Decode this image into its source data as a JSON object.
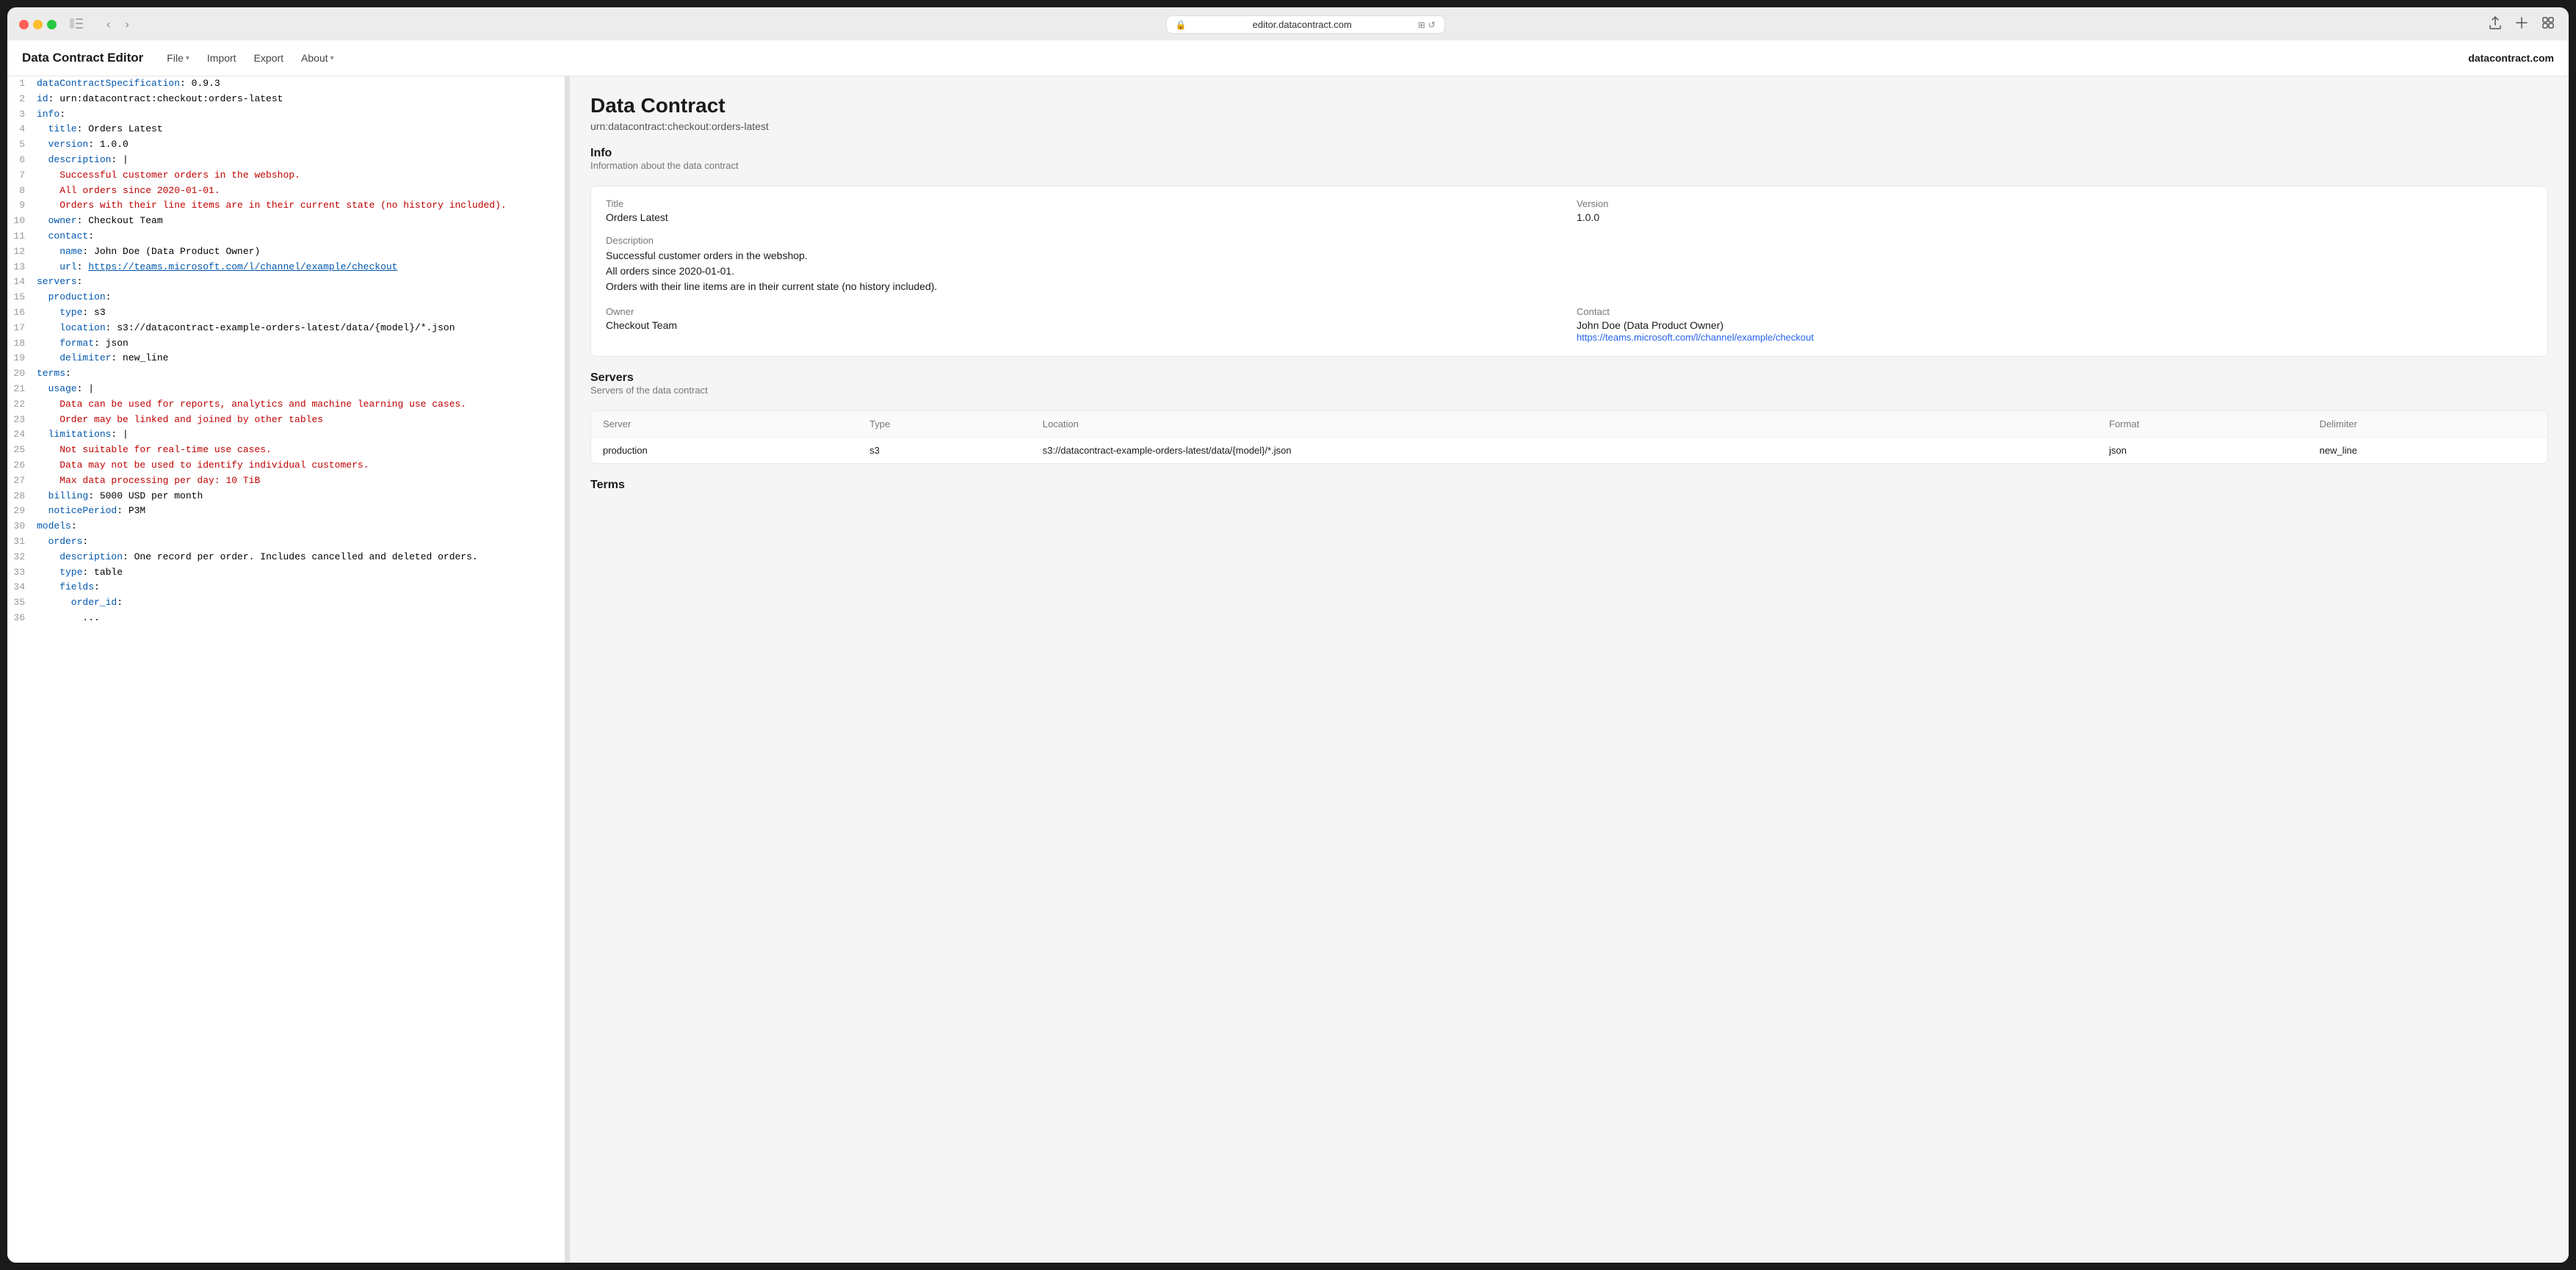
{
  "browser": {
    "url": "editor.datacontract.com",
    "back_title": "back",
    "forward_title": "forward"
  },
  "app": {
    "title": "Data Contract Editor",
    "site": "datacontract.com",
    "menu": {
      "file_label": "File",
      "import_label": "Import",
      "export_label": "Export",
      "about_label": "About"
    }
  },
  "editor": {
    "lines": [
      {
        "num": 1,
        "content": "dataContractSpecification: 0.9.3",
        "tokens": [
          {
            "text": "dataContractSpecification",
            "cls": "key"
          },
          {
            "text": ": 0.9.3",
            "cls": ""
          }
        ]
      },
      {
        "num": 2,
        "content": "id: urn:datacontract:checkout:orders-latest",
        "tokens": [
          {
            "text": "id",
            "cls": "key"
          },
          {
            "text": ": urn:datacontract:checkout:orders-latest",
            "cls": ""
          }
        ]
      },
      {
        "num": 3,
        "content": "info:",
        "tokens": [
          {
            "text": "info",
            "cls": "key"
          },
          {
            "text": ":",
            "cls": ""
          }
        ]
      },
      {
        "num": 4,
        "content": "  title: Orders Latest",
        "tokens": [
          {
            "text": "  title",
            "cls": "key"
          },
          {
            "text": ": Orders Latest",
            "cls": ""
          }
        ]
      },
      {
        "num": 5,
        "content": "  version: 1.0.0",
        "tokens": [
          {
            "text": "  version",
            "cls": "key"
          },
          {
            "text": ": 1.0.0",
            "cls": ""
          }
        ]
      },
      {
        "num": 6,
        "content": "  description: |",
        "tokens": [
          {
            "text": "  description",
            "cls": "key"
          },
          {
            "text": ": |",
            "cls": ""
          }
        ]
      },
      {
        "num": 7,
        "content": "    Successful customer orders in the webshop.",
        "tokens": [
          {
            "text": "    Successful customer orders in the webshop.",
            "cls": "string"
          }
        ]
      },
      {
        "num": 8,
        "content": "    All orders since 2020-01-01.",
        "tokens": [
          {
            "text": "    All orders since 2020-01-01.",
            "cls": "string"
          }
        ]
      },
      {
        "num": 9,
        "content": "    Orders with their line items are in their current state (no history included).",
        "tokens": [
          {
            "text": "    Orders with their line items are in their current state (no history included).",
            "cls": "string"
          }
        ]
      },
      {
        "num": 10,
        "content": "  owner: Checkout Team",
        "tokens": [
          {
            "text": "  owner",
            "cls": "key"
          },
          {
            "text": ": Checkout Team",
            "cls": ""
          }
        ]
      },
      {
        "num": 11,
        "content": "  contact:",
        "tokens": [
          {
            "text": "  contact",
            "cls": "key"
          },
          {
            "text": ":",
            "cls": ""
          }
        ]
      },
      {
        "num": 12,
        "content": "    name: John Doe (Data Product Owner)",
        "tokens": [
          {
            "text": "    name",
            "cls": "key"
          },
          {
            "text": ": John Doe (Data Product Owner)",
            "cls": ""
          }
        ]
      },
      {
        "num": 13,
        "content": "    url: https://teams.microsoft.com/l/channel/example/checkout",
        "tokens": [
          {
            "text": "    url",
            "cls": "key"
          },
          {
            "text": ": ",
            "cls": ""
          },
          {
            "text": "https://teams.microsoft.com/l/channel/example/checkout",
            "cls": "url-text"
          }
        ]
      },
      {
        "num": 14,
        "content": "servers:",
        "tokens": [
          {
            "text": "servers",
            "cls": "key"
          },
          {
            "text": ":",
            "cls": ""
          }
        ]
      },
      {
        "num": 15,
        "content": "  production:",
        "tokens": [
          {
            "text": "  production",
            "cls": "key"
          },
          {
            "text": ":",
            "cls": ""
          }
        ]
      },
      {
        "num": 16,
        "content": "    type: s3",
        "tokens": [
          {
            "text": "    type",
            "cls": "key"
          },
          {
            "text": ": s3",
            "cls": ""
          }
        ]
      },
      {
        "num": 17,
        "content": "    location: s3://datacontract-example-orders-latest/data/{model}/*.json",
        "tokens": [
          {
            "text": "    location",
            "cls": "key"
          },
          {
            "text": ": s3://datacontract-example-orders-latest/data/{model}/*.json",
            "cls": ""
          }
        ]
      },
      {
        "num": 18,
        "content": "    format: json",
        "tokens": [
          {
            "text": "    format",
            "cls": "key"
          },
          {
            "text": ": json",
            "cls": ""
          }
        ]
      },
      {
        "num": 19,
        "content": "    delimiter: new_line",
        "tokens": [
          {
            "text": "    delimiter",
            "cls": "key"
          },
          {
            "text": ": new_line",
            "cls": ""
          }
        ]
      },
      {
        "num": 20,
        "content": "terms:",
        "tokens": [
          {
            "text": "terms",
            "cls": "key"
          },
          {
            "text": ":",
            "cls": ""
          }
        ]
      },
      {
        "num": 21,
        "content": "  usage: |",
        "tokens": [
          {
            "text": "  usage",
            "cls": "key"
          },
          {
            "text": ": |",
            "cls": ""
          }
        ]
      },
      {
        "num": 22,
        "content": "    Data can be used for reports, analytics and machine learning use cases.",
        "tokens": [
          {
            "text": "    Data can be used for reports, analytics and machine learning use cases.",
            "cls": "string"
          }
        ]
      },
      {
        "num": 23,
        "content": "    Order may be linked and joined by other tables",
        "tokens": [
          {
            "text": "    Order may be linked and joined by other tables",
            "cls": "string"
          }
        ]
      },
      {
        "num": 24,
        "content": "  limitations: |",
        "tokens": [
          {
            "text": "  limitations",
            "cls": "key"
          },
          {
            "text": ": |",
            "cls": ""
          }
        ]
      },
      {
        "num": 25,
        "content": "    Not suitable for real-time use cases.",
        "tokens": [
          {
            "text": "    Not suitable for real-time use cases.",
            "cls": "string"
          }
        ]
      },
      {
        "num": 26,
        "content": "    Data may not be used to identify individual customers.",
        "tokens": [
          {
            "text": "    Data may not be used to identify individual customers.",
            "cls": "string"
          }
        ]
      },
      {
        "num": 27,
        "content": "    Max data processing per day: 10 TiB",
        "tokens": [
          {
            "text": "    Max data processing per day: 10 TiB",
            "cls": "string"
          }
        ]
      },
      {
        "num": 28,
        "content": "  billing: 5000 USD per month",
        "tokens": [
          {
            "text": "  billing",
            "cls": "key"
          },
          {
            "text": ": 5000 USD per month",
            "cls": ""
          }
        ]
      },
      {
        "num": 29,
        "content": "  noticePeriod: P3M",
        "tokens": [
          {
            "text": "  noticePeriod",
            "cls": "key"
          },
          {
            "text": ": P3M",
            "cls": ""
          }
        ]
      },
      {
        "num": 30,
        "content": "models:",
        "tokens": [
          {
            "text": "models",
            "cls": "key"
          },
          {
            "text": ":",
            "cls": ""
          }
        ]
      },
      {
        "num": 31,
        "content": "  orders:",
        "tokens": [
          {
            "text": "  orders",
            "cls": "key"
          },
          {
            "text": ":",
            "cls": ""
          }
        ]
      },
      {
        "num": 32,
        "content": "    description: One record per order. Includes cancelled and deleted orders.",
        "tokens": [
          {
            "text": "    description",
            "cls": "key"
          },
          {
            "text": ": One record per order. Includes cancelled and deleted orders.",
            "cls": ""
          }
        ]
      },
      {
        "num": 33,
        "content": "    type: table",
        "tokens": [
          {
            "text": "    type",
            "cls": "key"
          },
          {
            "text": ": table",
            "cls": ""
          }
        ]
      },
      {
        "num": 34,
        "content": "    fields:",
        "tokens": [
          {
            "text": "    fields",
            "cls": "key"
          },
          {
            "text": ":",
            "cls": ""
          }
        ]
      },
      {
        "num": 35,
        "content": "      order_id:",
        "tokens": [
          {
            "text": "      order_id",
            "cls": "key"
          },
          {
            "text": ":",
            "cls": ""
          }
        ]
      },
      {
        "num": 36,
        "content": "        ...",
        "tokens": [
          {
            "text": "        ...",
            "cls": ""
          }
        ]
      }
    ]
  },
  "preview": {
    "title": "Data Contract",
    "subtitle": "urn:datacontract:checkout:orders-latest",
    "info_section": {
      "title": "Info",
      "description": "Information about the data contract"
    },
    "info_card": {
      "title_label": "Title",
      "version_label": "Version",
      "title_value": "Orders Latest",
      "version_value": "1.0.0",
      "description_label": "Description",
      "description_line1": "Successful customer orders in the webshop.",
      "description_line2": "All orders since 2020-01-01.",
      "description_line3": "Orders with their line items are in their current state (no history included).",
      "owner_label": "Owner",
      "contact_label": "Contact",
      "owner_value": "Checkout Team",
      "contact_name": "John Doe (Data Product Owner)",
      "contact_url": "https://teams.microsoft.com/l/channel/example/checkout"
    },
    "servers_section": {
      "title": "Servers",
      "description": "Servers of the data contract"
    },
    "servers_table": {
      "columns": [
        "Server",
        "Type",
        "Location",
        "Format",
        "Delimiter"
      ],
      "rows": [
        {
          "server": "production",
          "type": "s3",
          "location": "s3://datacontract-example-orders-latest/data/{model}/*.json",
          "format": "json",
          "delimiter": "new_line"
        }
      ]
    },
    "terms_section": {
      "title": "Terms"
    }
  }
}
